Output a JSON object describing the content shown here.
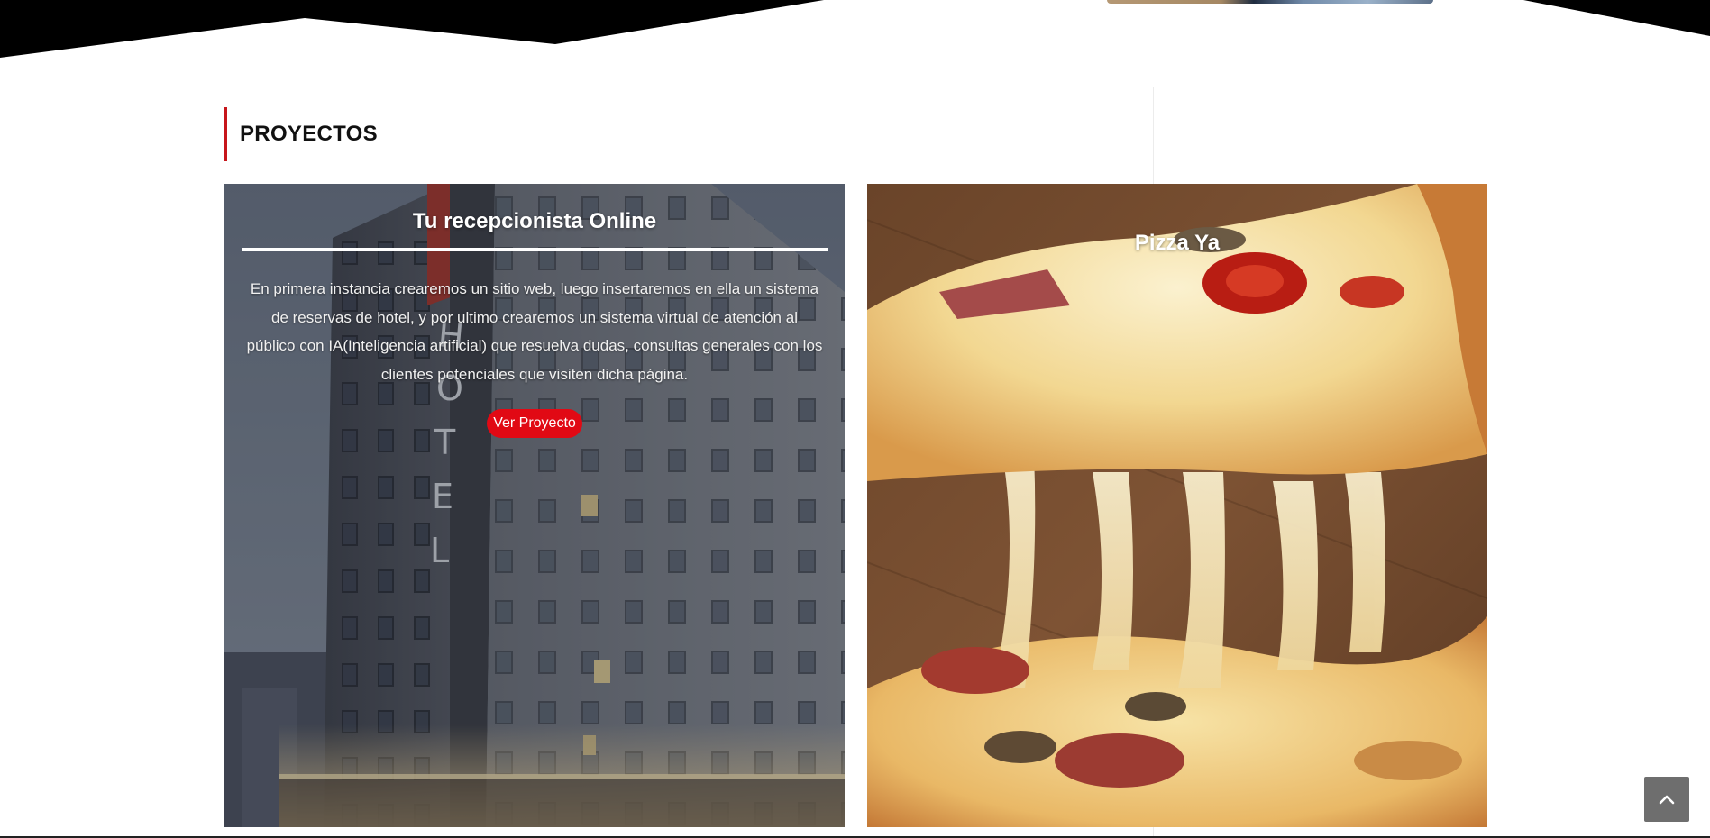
{
  "section": {
    "heading": "PROYECTOS"
  },
  "projects": [
    {
      "title": "Tu recepcionista Online",
      "description": "En primera instancia crearemos un sitio web, luego insertaremos en ella un sistema de reservas de hotel, y por ultimo crearemos un sistema virtual de atención al público con IA(Inteligencia artificial) que resuelva dudas, consultas generales con los clientes potenciales que visiten dicha página.",
      "button_label": "Ver Proyecto",
      "image": "hotel-building-photo"
    },
    {
      "title": "Pizza Ya",
      "image": "cheese-pizza-slice-photo"
    }
  ],
  "scroll_top": {
    "icon": "chevron-up-icon"
  },
  "colors": {
    "accent": "#c7161b",
    "button": "#e10914",
    "divider": "#000000"
  }
}
